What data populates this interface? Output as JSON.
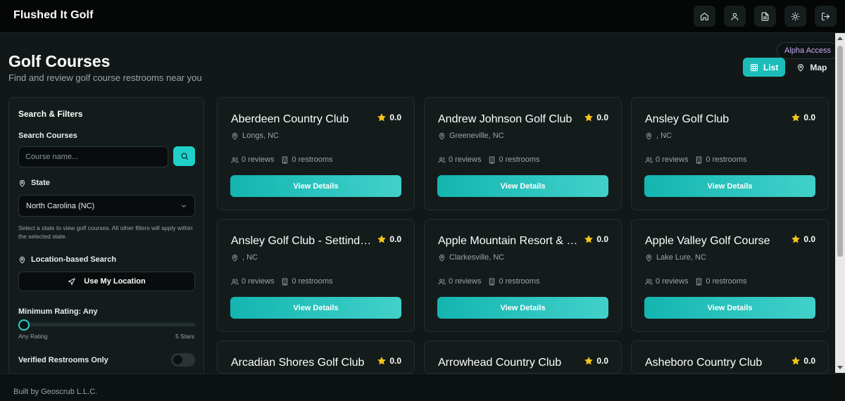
{
  "app": {
    "title": "Flushed It Golf"
  },
  "nav": {
    "icons": [
      "home-icon",
      "user-icon",
      "document-icon",
      "sun-icon",
      "logout-icon"
    ]
  },
  "header": {
    "title": "Golf Courses",
    "subtitle": "Find and review golf course restrooms near you",
    "badge": "Alpha Access",
    "view_list": "List",
    "view_map": "Map",
    "active_view": "List"
  },
  "filters": {
    "heading": "Search & Filters",
    "search_label": "Search Courses",
    "search_placeholder": "Course name...",
    "search_value": "",
    "state_label": "State",
    "state_value": "North Carolina (NC)",
    "state_hint": "Select a state to view golf courses. All other filters will apply within the selected state.",
    "location_label": "Location-based Search",
    "location_button": "Use My Location",
    "rating_label": "Minimum Rating: Any",
    "rating_value": 0,
    "rating_min_label": "Any Rating",
    "rating_max_label": "5 Stars",
    "verified_label": "Verified Restrooms Only",
    "verified_on": false
  },
  "courses": [
    {
      "name": "Aberdeen Country Club",
      "location": "Longs, NC",
      "rating": "0.0",
      "reviews": "0 reviews",
      "restrooms": "0 restrooms",
      "button": "View Details"
    },
    {
      "name": "Andrew Johnson Golf Club",
      "location": "Greeneville, NC",
      "rating": "0.0",
      "reviews": "0 reviews",
      "restrooms": "0 restrooms",
      "button": "View Details"
    },
    {
      "name": "Ansley Golf Club",
      "location": ", NC",
      "rating": "0.0",
      "reviews": "0 reviews",
      "restrooms": "0 restrooms",
      "button": "View Details"
    },
    {
      "name": "Ansley Golf Club - Settindown Creek",
      "location": ", NC",
      "rating": "0.0",
      "reviews": "0 reviews",
      "restrooms": "0 restrooms",
      "button": "View Details"
    },
    {
      "name": "Apple Mountain Resort & Golf Club",
      "location": "Clarkesville, NC",
      "rating": "0.0",
      "reviews": "0 reviews",
      "restrooms": "0 restrooms",
      "button": "View Details"
    },
    {
      "name": "Apple Valley Golf Course",
      "location": "Lake Lure, NC",
      "rating": "0.0",
      "reviews": "0 reviews",
      "restrooms": "0 restrooms",
      "button": "View Details"
    },
    {
      "name": "Arcadian Shores Golf Club",
      "location": "",
      "rating": "0.0",
      "reviews": "",
      "restrooms": "",
      "button": ""
    },
    {
      "name": "Arrowhead Country Club",
      "location": "",
      "rating": "0.0",
      "reviews": "",
      "restrooms": "",
      "button": ""
    },
    {
      "name": "Asheboro Country Club",
      "location": "",
      "rating": "0.0",
      "reviews": "",
      "restrooms": "",
      "button": ""
    }
  ],
  "footer": {
    "text": "Built by Geoscrub L.L.C."
  },
  "colors": {
    "accent": "#1fd0ca",
    "star": "#f5c518",
    "badge_text": "#c9a8f2",
    "background": "#121818"
  }
}
